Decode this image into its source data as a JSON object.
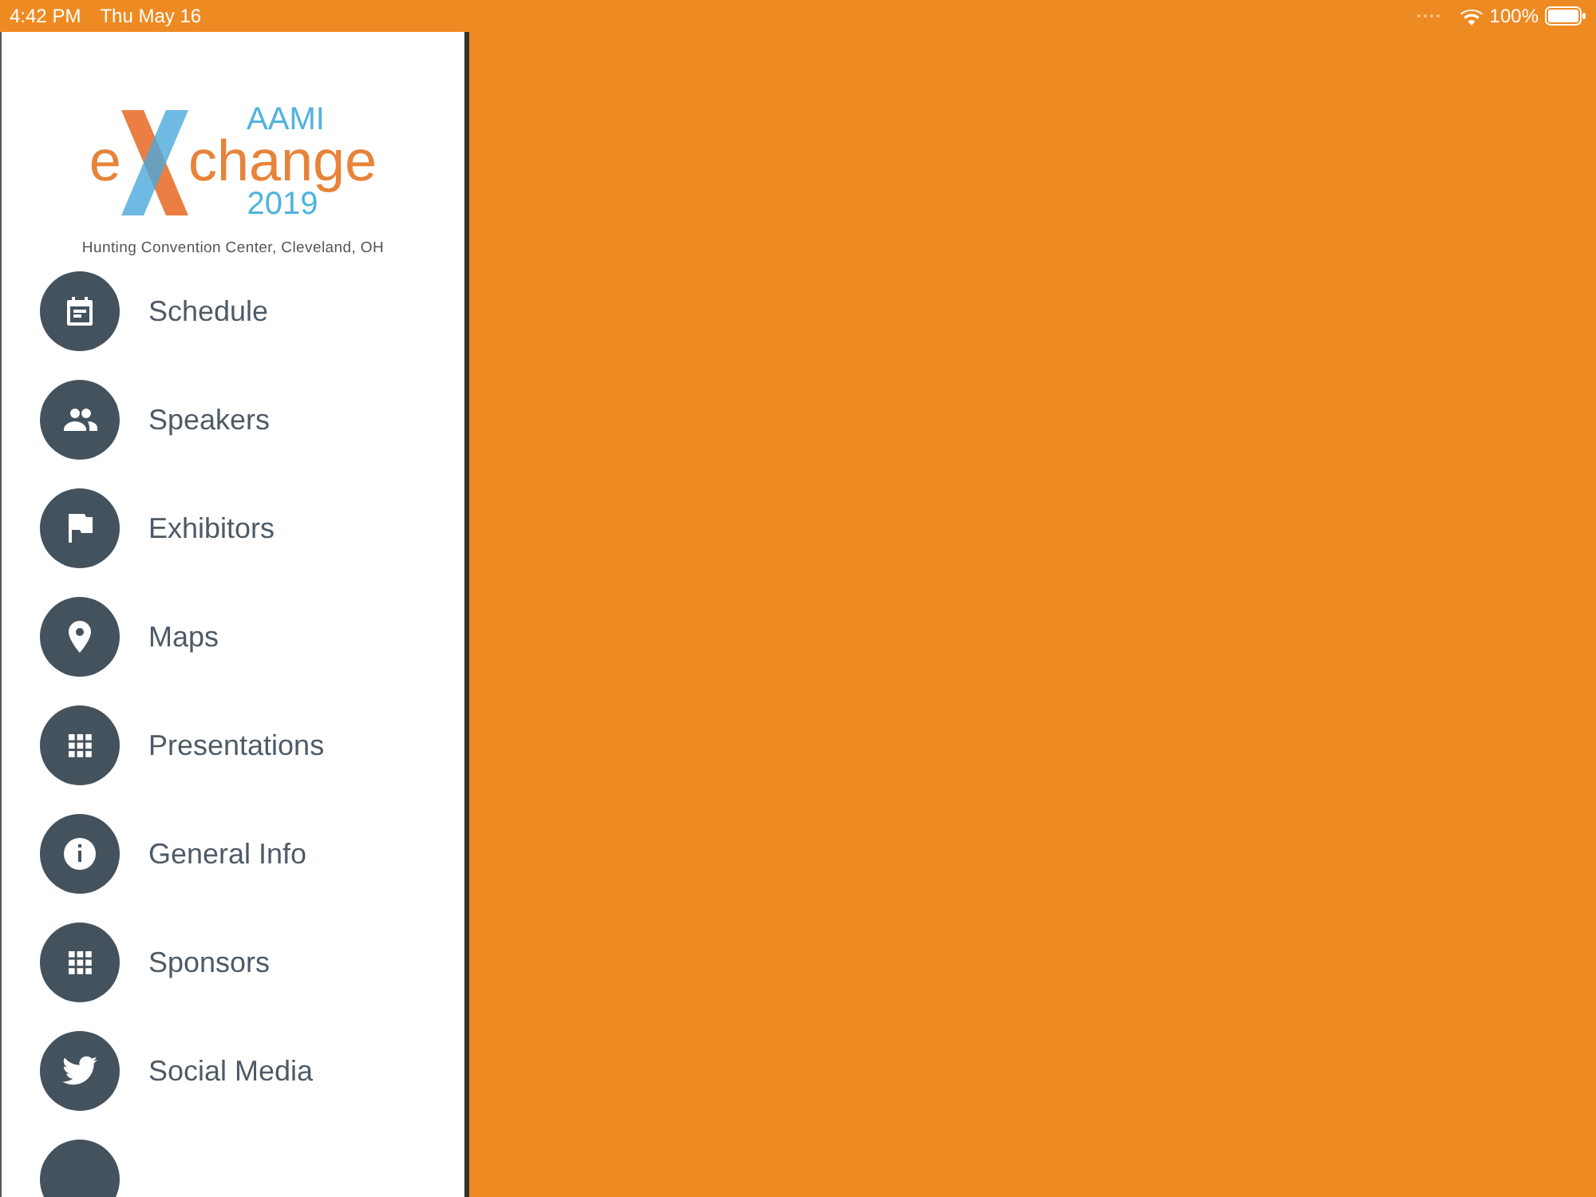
{
  "status_bar": {
    "time": "4:42 PM",
    "date": "Thu May 16",
    "battery": "100%"
  },
  "logo": {
    "top": "AAMI",
    "left": "e",
    "right": "change",
    "year": "2019"
  },
  "venue": "Hunting Convention Center, Cleveland, OH",
  "menu": [
    {
      "label": "Schedule",
      "kind": "calendar"
    },
    {
      "label": "Speakers",
      "kind": "people"
    },
    {
      "label": "Exhibitors",
      "kind": "flag"
    },
    {
      "label": "Maps",
      "kind": "pin"
    },
    {
      "label": "Presentations",
      "kind": "grid"
    },
    {
      "label": "General Info",
      "kind": "info"
    },
    {
      "label": "Sponsors",
      "kind": "grid"
    },
    {
      "label": "Social Media",
      "kind": "bird"
    },
    {
      "kind": "blank"
    }
  ]
}
